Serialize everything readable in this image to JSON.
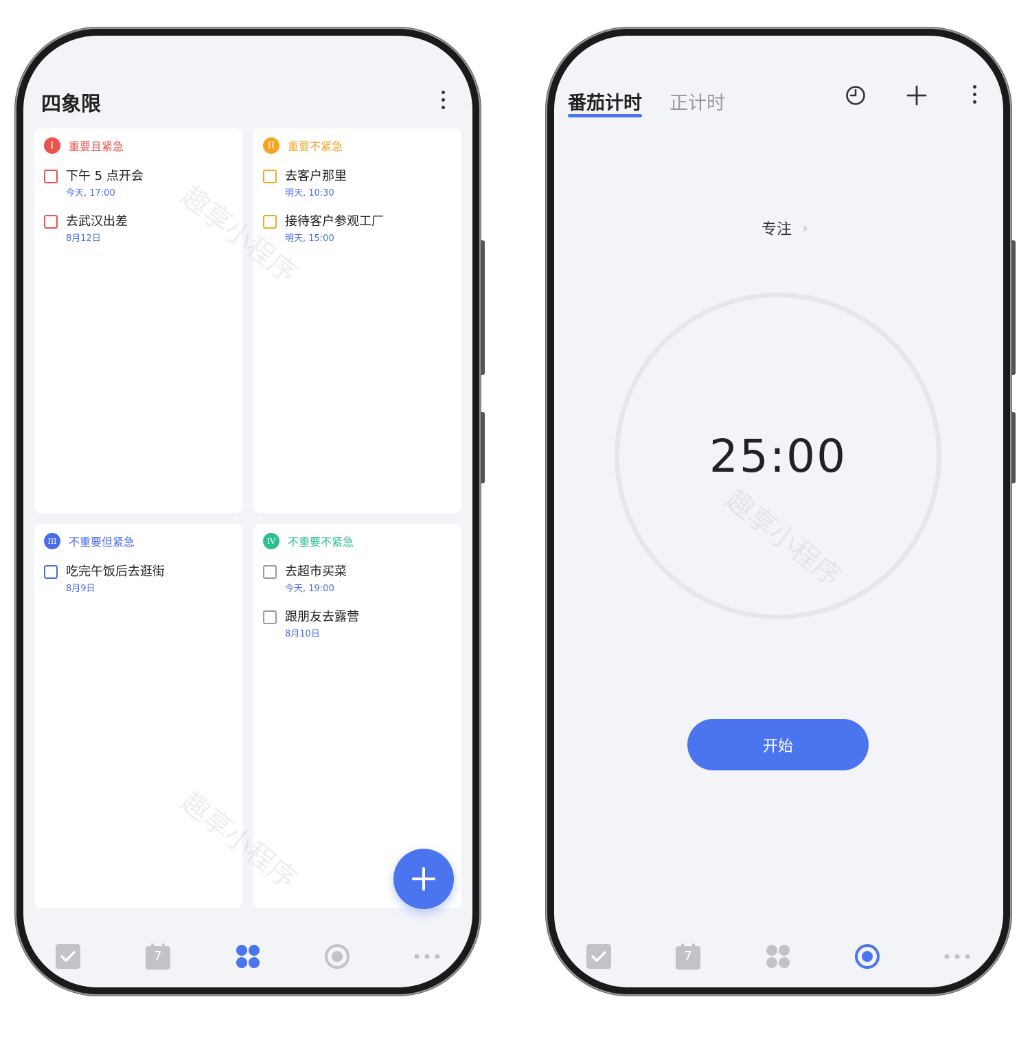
{
  "left_screen": {
    "title": "四象限",
    "quadrants": [
      {
        "numeral": "I",
        "title": "重要且紧急",
        "color": "#e9534b",
        "tasks": [
          {
            "text": "下午 5 点开会",
            "date": "今天, 17:00"
          },
          {
            "text": "去武汉出差",
            "date": "8月12日"
          }
        ]
      },
      {
        "numeral": "II",
        "title": "重要不紧急",
        "color": "#f5a524",
        "tasks": [
          {
            "text": "去客户那里",
            "date": "明天, 10:30"
          },
          {
            "text": "接待客户参观工厂",
            "date": "明天, 15:00"
          }
        ]
      },
      {
        "numeral": "III",
        "title": "不重要但紧急",
        "color": "#4a6ce8",
        "tasks": [
          {
            "text": "吃完午饭后去逛街",
            "date": "8月9日"
          }
        ]
      },
      {
        "numeral": "IV",
        "title": "不重要不紧急",
        "color": "#2fbf8c",
        "tasks": [
          {
            "text": "去超市买菜",
            "date": "今天, 19:00"
          },
          {
            "text": "跟朋友去露营",
            "date": "8月10日"
          }
        ]
      }
    ],
    "watermark": "趣享小程序"
  },
  "right_screen": {
    "tabs": [
      "番茄计时",
      "正计时"
    ],
    "focus_label": "专注",
    "timer": "25:00",
    "start_label": "开始",
    "watermark": "趣享小程序"
  },
  "nav_icons": [
    "checkbox-icon",
    "calendar-icon",
    "quadrant-icon",
    "pomodoro-icon",
    "more-icon"
  ],
  "calendar_day": "7",
  "colors": {
    "accent": "#4b74ef",
    "nav_inactive": "#c2c3c6",
    "background": "#f3f4f8"
  }
}
